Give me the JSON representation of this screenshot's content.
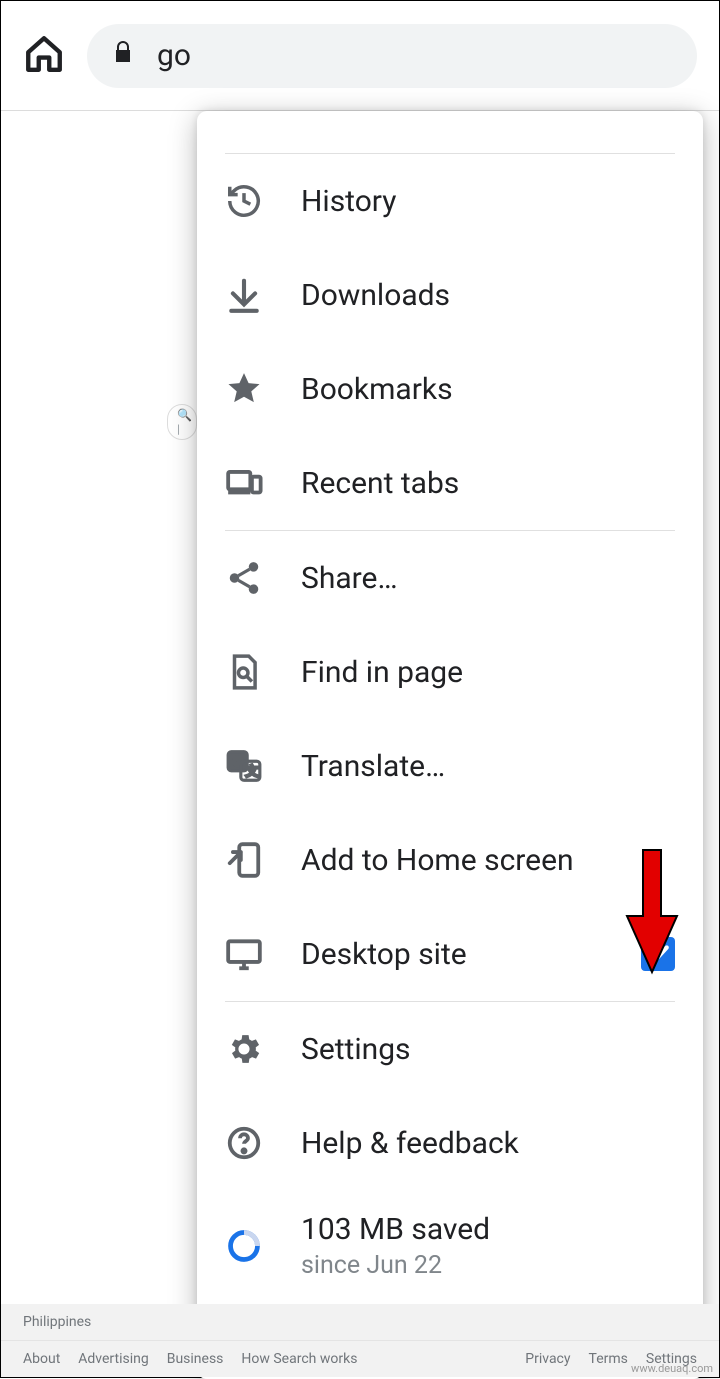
{
  "toolbar": {
    "url_fragment": "go"
  },
  "menu": {
    "history": "History",
    "downloads": "Downloads",
    "bookmarks": "Bookmarks",
    "recent_tabs": "Recent tabs",
    "share": "Share…",
    "find_in_page": "Find in page",
    "translate": "Translate…",
    "add_to_home": "Add to Home screen",
    "desktop_site": "Desktop site",
    "desktop_site_checked": true,
    "settings": "Settings",
    "help": "Help & feedback",
    "data_saved_line1": "103 MB saved",
    "data_saved_line2": "since Jun 22"
  },
  "footer": {
    "region": "Philippines",
    "links_left": [
      "About",
      "Advertising",
      "Business",
      "How Search works"
    ],
    "links_right": [
      "Privacy",
      "Terms",
      "Settings"
    ]
  },
  "watermark": "www.deuaq.com"
}
